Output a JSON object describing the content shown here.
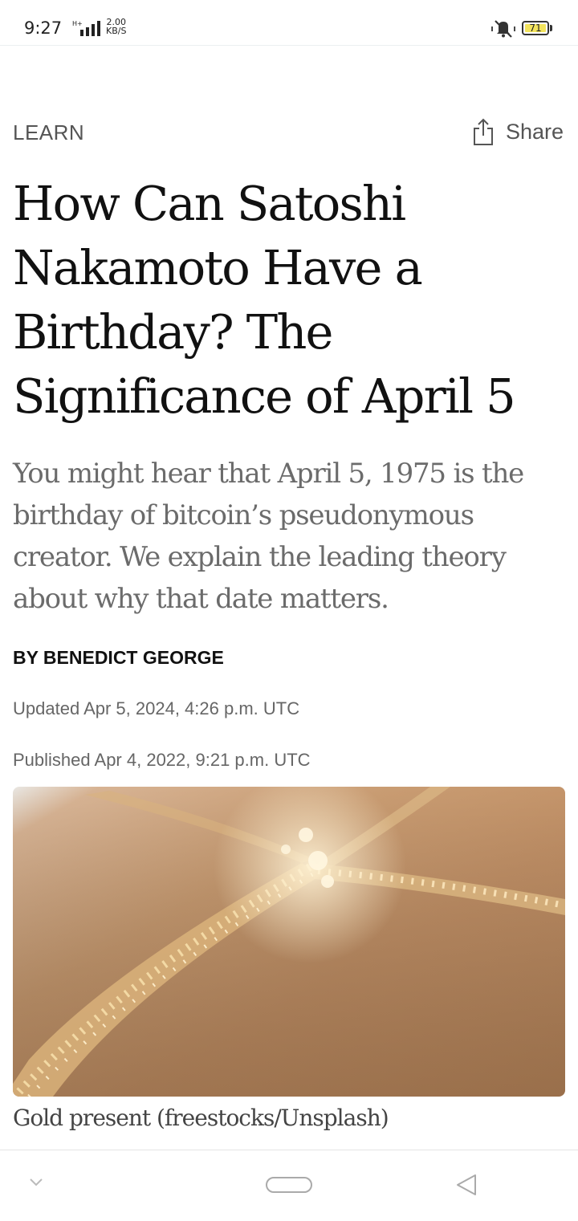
{
  "status_bar": {
    "time": "9:27",
    "network_type": "H+",
    "net_speed_value": "2.00",
    "net_speed_unit": "KB/S",
    "battery_level": "71",
    "battery_color": "#f2e35c"
  },
  "article": {
    "category": "LEARN",
    "share_label": "Share",
    "headline": "How Can Satoshi Nakamoto Have a Birthday? The Significance of April 5",
    "dek": "You might hear that April 5, 1975 is the birthday of bitcoin’s pseudonymous creator. We explain the leading theory about why that date matters.",
    "byline": "BY BENEDICT GEORGE",
    "updated": "Updated Apr 5, 2024, 4:26 p.m. UTC",
    "published": "Published Apr 4, 2022, 9:21 p.m. UTC",
    "image_caption": "Gold present (freestocks/Unsplash)"
  },
  "icons": {
    "share": "share-icon",
    "signal": "signal-icon",
    "mute": "vibrate-mute-icon",
    "battery": "battery-icon",
    "nav_down": "chevron-down-icon",
    "nav_home": "home-pill-icon",
    "nav_back": "back-triangle-icon"
  }
}
